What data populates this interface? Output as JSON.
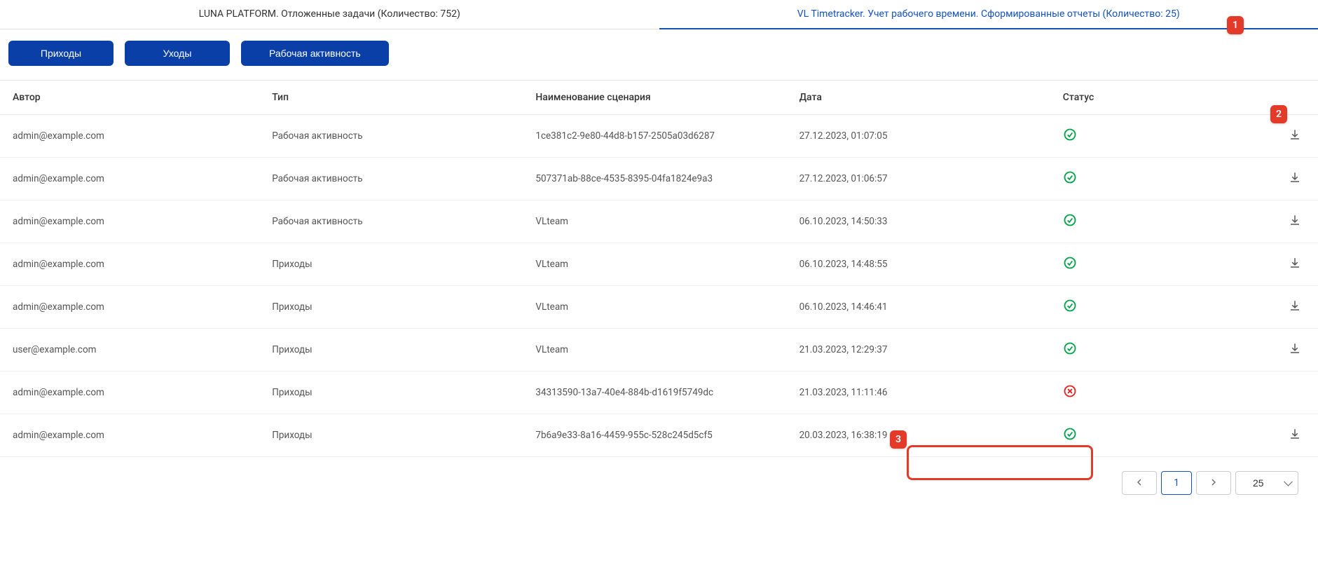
{
  "tabs": {
    "left": "LUNA PLATFORM. Отложенные задачи (Количество: 752)",
    "right": "VL Timetracker. Учет рабочего времени. Сформированные отчеты (Количество: 25)"
  },
  "toolbar": {
    "arrivals": "Приходы",
    "departures": "Уходы",
    "activity": "Рабочая активность"
  },
  "columns": {
    "author": "Автор",
    "type": "Тип",
    "scenario": "Наименование сценария",
    "date": "Дата",
    "status": "Статус"
  },
  "rows": [
    {
      "author": "admin@example.com",
      "type": "Рабочая активность",
      "scenario": "1ce381c2-9e80-44d8-b157-2505a03d6287",
      "date": "27.12.2023, 01:07:05",
      "status": "ok"
    },
    {
      "author": "admin@example.com",
      "type": "Рабочая активность",
      "scenario": "507371ab-88ce-4535-8395-04fa1824e9a3",
      "date": "27.12.2023, 01:06:57",
      "status": "ok"
    },
    {
      "author": "admin@example.com",
      "type": "Рабочая активность",
      "scenario": "VLteam",
      "date": "06.10.2023, 14:50:33",
      "status": "ok"
    },
    {
      "author": "admin@example.com",
      "type": "Приходы",
      "scenario": "VLteam",
      "date": "06.10.2023, 14:48:55",
      "status": "ok"
    },
    {
      "author": "admin@example.com",
      "type": "Приходы",
      "scenario": "VLteam",
      "date": "06.10.2023, 14:46:41",
      "status": "ok"
    },
    {
      "author": "user@example.com",
      "type": "Приходы",
      "scenario": "VLteam",
      "date": "21.03.2023, 12:29:37",
      "status": "ok"
    },
    {
      "author": "admin@example.com",
      "type": "Приходы",
      "scenario": "34313590-13a7-40e4-884b-d1619f5749dc",
      "date": "21.03.2023, 11:11:46",
      "status": "err"
    },
    {
      "author": "admin@example.com",
      "type": "Приходы",
      "scenario": "7b6a9e33-8a16-4459-955c-528c245d5cf5",
      "date": "20.03.2023, 16:38:19",
      "status": "ok"
    }
  ],
  "pager": {
    "current": "1",
    "size": "25"
  },
  "callouts": {
    "c1": "1",
    "c2": "2",
    "c3": "3"
  }
}
